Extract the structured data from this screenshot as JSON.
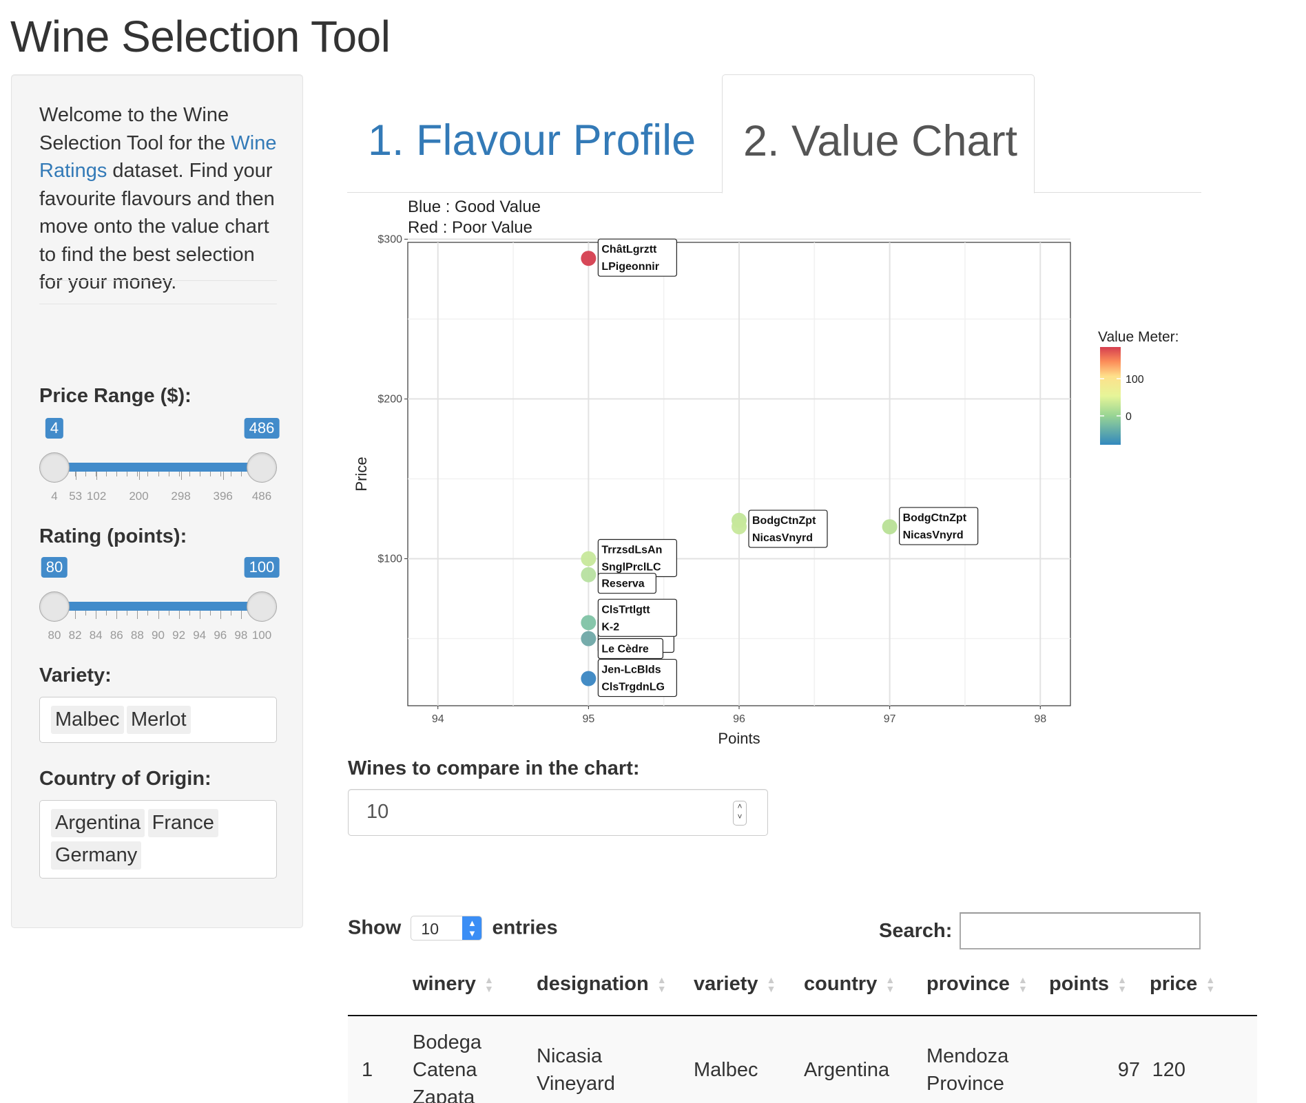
{
  "app": {
    "title": "Wine Selection Tool"
  },
  "sidebar": {
    "intro_before": "Welcome to the Wine Selection Tool for the ",
    "intro_link": "Wine Ratings",
    "intro_after": " dataset. Find your favourite flavours and then move onto the value chart to find the best selection for your money.",
    "price": {
      "label": "Price Range ($):",
      "min": 4,
      "max": 486,
      "low": "4",
      "high": "486",
      "tick_labels": [
        "4",
        "53",
        "102",
        "200",
        "298",
        "396",
        "486"
      ]
    },
    "rating": {
      "label": "Rating (points):",
      "min": 80,
      "max": 100,
      "low": "80",
      "high": "100",
      "tick_labels": [
        "80",
        "82",
        "84",
        "86",
        "88",
        "90",
        "92",
        "94",
        "96",
        "98",
        "100"
      ]
    },
    "variety": {
      "label": "Variety:",
      "selected": [
        "Malbec",
        "Merlot"
      ]
    },
    "country": {
      "label": "Country of Origin:",
      "selected": [
        "Argentina",
        "France",
        "Germany"
      ]
    }
  },
  "tabs": [
    {
      "label": "1. Flavour Profile",
      "active": false
    },
    {
      "label": "2. Value Chart",
      "active": true
    }
  ],
  "chart_data": {
    "type": "scatter",
    "subtitle_lines": [
      "Blue : Good Value",
      "Red : Poor Value"
    ],
    "xlabel": "Points",
    "ylabel": "Price",
    "xlim": [
      93.8,
      98.2
    ],
    "ylim": [
      8,
      298
    ],
    "x_ticks": [
      "94",
      "95",
      "96",
      "97",
      "98"
    ],
    "y_ticks": [
      "$100",
      "$200",
      "$300"
    ],
    "grid": true,
    "legend": {
      "title": "Value Meter:",
      "position": "right",
      "ticks": [
        "100",
        "0"
      ]
    },
    "points": [
      {
        "x": 95,
        "y": 288,
        "value": 165,
        "color": "#d53e4f",
        "label": [
          "ChâtLgrztt",
          "LPigeonnir"
        ]
      },
      {
        "x": 96,
        "y": 124,
        "value": 20,
        "color": "#c2e699",
        "label": []
      },
      {
        "x": 96,
        "y": 120,
        "value": 18,
        "color": "#c7e89b",
        "label": [
          "BodgCtnZpt",
          "NicasVnyrd"
        ]
      },
      {
        "x": 97,
        "y": 120,
        "value": 15,
        "color": "#b8e096",
        "label": [
          "BodgCtnZpt",
          "NicasVnyrd"
        ]
      },
      {
        "x": 95,
        "y": 100,
        "value": 10,
        "color": "#c7e89b",
        "label": [
          "TrrzsdLsAn",
          "SnglPrclLC"
        ]
      },
      {
        "x": 95,
        "y": 90,
        "value": 5,
        "color": "#b7e0a0",
        "label": [
          "Reserva"
        ]
      },
      {
        "x": 95,
        "y": 60,
        "value": -40,
        "color": "#7fc3a5",
        "label": [
          "ClsTrtlgtt",
          "K-2"
        ]
      },
      {
        "x": 95,
        "y": 50,
        "value": -55,
        "color": "#6fa8a6",
        "label": [
          "Le Cèdre"
        ]
      },
      {
        "x": 95,
        "y": 25,
        "value": -90,
        "color": "#3a86c2",
        "label": [
          "Jen-LcBlds",
          "ClsTrgdnLG"
        ]
      }
    ],
    "hidden_label_fragment": "dr"
  },
  "compare": {
    "label": "Wines to compare in the chart:",
    "value": "10"
  },
  "table": {
    "show_label": "Show",
    "entries_value": "10",
    "entries_label": "entries",
    "search_label": "Search:",
    "search_value": "",
    "columns": [
      "winery",
      "designation",
      "variety",
      "country",
      "province",
      "points",
      "price"
    ],
    "rows": [
      {
        "index": "1",
        "winery": "Bodega Catena Zapata",
        "designation": "Nicasia Vineyard",
        "variety": "Malbec",
        "country": "Argentina",
        "province": "Mendoza Province",
        "points": "97",
        "price": "120"
      }
    ]
  }
}
